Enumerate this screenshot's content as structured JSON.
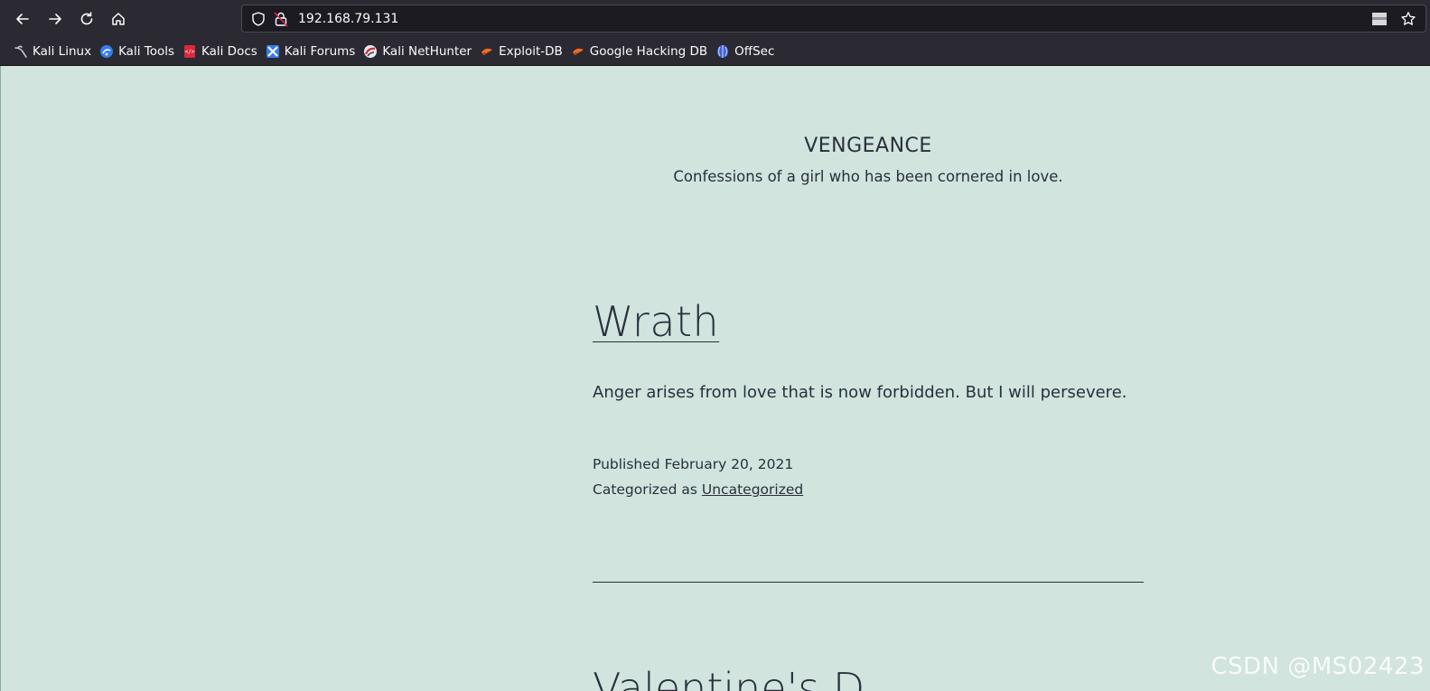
{
  "browser": {
    "url": "192.168.79.131",
    "bookmarks": [
      {
        "label": "Kali Linux",
        "icon": "kali-dragon-icon"
      },
      {
        "label": "Kali Tools",
        "icon": "kali-tools-icon"
      },
      {
        "label": "Kali Docs",
        "icon": "kali-docs-icon"
      },
      {
        "label": "Kali Forums",
        "icon": "kali-forums-icon"
      },
      {
        "label": "Kali NetHunter",
        "icon": "kali-nethunter-icon"
      },
      {
        "label": "Exploit-DB",
        "icon": "exploit-db-icon"
      },
      {
        "label": "Google Hacking DB",
        "icon": "ghdb-icon"
      },
      {
        "label": "OffSec",
        "icon": "offsec-icon"
      }
    ],
    "colors": {
      "toolbar": "#2b2a33",
      "urlbar": "#1c1b22"
    }
  },
  "site": {
    "title": "VENGEANCE",
    "description": "Confessions of a girl who has been cornered in love."
  },
  "post": {
    "title": "Wrath",
    "body": "Anger arises from love that is now forbidden. But I will persevere.",
    "published_prefix": "Published",
    "published_date": "February 20, 2021",
    "category_prefix": "Categorized as",
    "category": "Uncategorized"
  },
  "next_post": {
    "title_partial": "Valentine's D"
  },
  "watermark": "CSDN @MS02423",
  "colors": {
    "page_bg": "#d1e4dd",
    "text": "#28303d"
  }
}
